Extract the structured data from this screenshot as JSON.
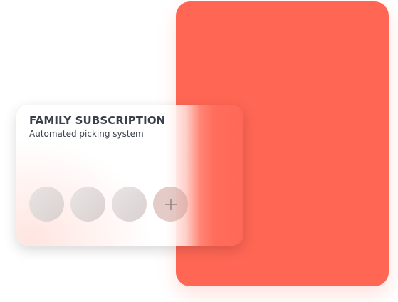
{
  "colors": {
    "accent": "#ff6654",
    "title_text": "#3a3f4b",
    "avatar_placeholder": "#ddd6d5"
  },
  "card": {
    "title": "FAMILY SUBSCRIPTION",
    "subtitle": "Automated picking system",
    "members": [
      {
        "icon": "avatar-placeholder"
      },
      {
        "icon": "avatar-placeholder"
      },
      {
        "icon": "avatar-placeholder"
      }
    ],
    "add_member_icon": "plus-icon"
  }
}
